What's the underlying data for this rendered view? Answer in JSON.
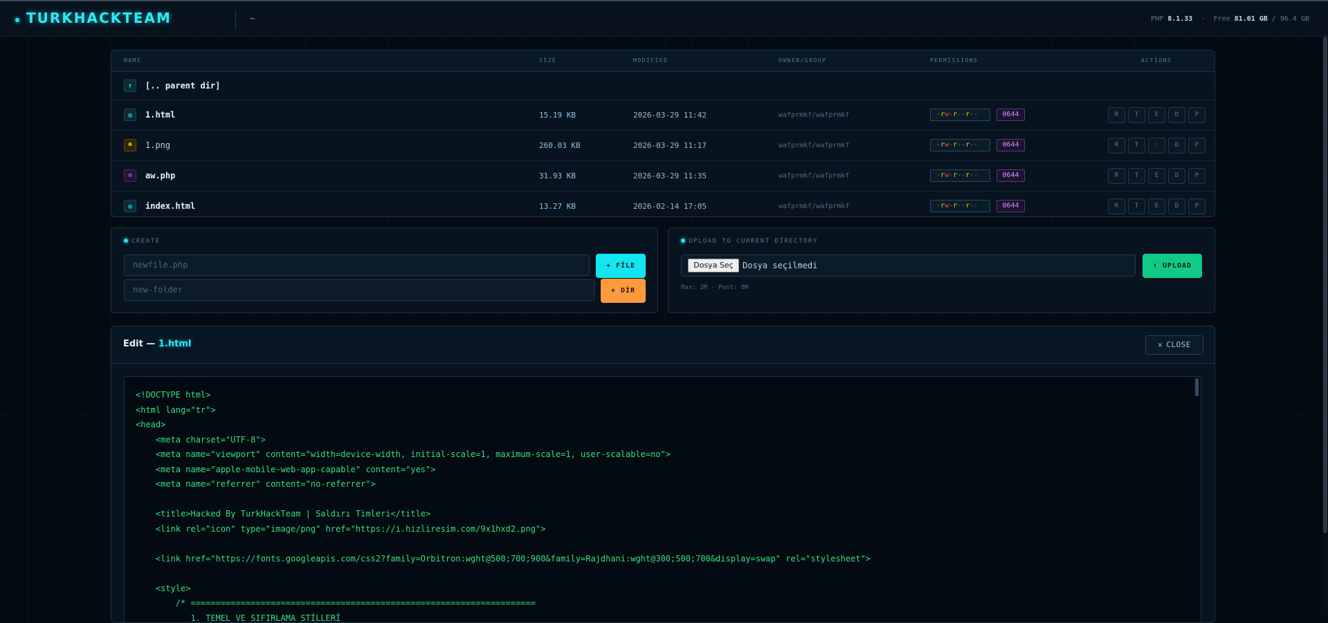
{
  "header": {
    "brand": "TURKHACKTEAM",
    "path": "~",
    "php_label": "PHP",
    "php_version": "8.1.33",
    "dot": "·",
    "free_label": "Free",
    "free_value": "81.01 GB",
    "slash": "/",
    "total_value": "96.4 GB"
  },
  "table": {
    "columns": {
      "name": "NAME",
      "size": "SİZE",
      "modified": "MODİFİED",
      "owner": "OWNER/GROUP",
      "permissions": "PERMİSSİONS",
      "actions": "ACTİONS"
    },
    "parent_label": "[.. parent dir]",
    "files": [
      {
        "name": "1.html",
        "icon": "html-file-icon",
        "glyph": "▥",
        "size": "15.19 KB",
        "modified": "2026-03-29 11:42",
        "owner": "wafprmkf/wafprmkf",
        "octal": "0644"
      },
      {
        "name": "1.png",
        "icon": "image-file-icon",
        "glyph": "☻",
        "size": "260.03 KB",
        "modified": "2026-03-29 11:17",
        "owner": "wafprmkf/wafprmkf",
        "octal": "0644"
      },
      {
        "name": "aw.php",
        "icon": "php-file-icon",
        "glyph": "⚙",
        "size": "31.93 KB",
        "modified": "2026-03-29 11:35",
        "owner": "wafprmkf/wafprmkf",
        "octal": "0644"
      },
      {
        "name": "index.html",
        "icon": "html-file-icon",
        "glyph": "▥",
        "size": "13.27 KB",
        "modified": "2026-02-14 17:05",
        "owner": "wafprmkf/wafprmkf",
        "octal": "0644"
      }
    ],
    "perm_parts": [
      "-",
      "rw",
      "-",
      "r",
      "--",
      "r",
      "--"
    ],
    "actions": [
      "R",
      "T",
      "E",
      "D",
      "P"
    ]
  },
  "create": {
    "title": "CREATE",
    "file_placeholder": "newfile.php",
    "file_button": "+ FİLE",
    "dir_placeholder": "new-folder",
    "dir_button": "+ DİR"
  },
  "upload": {
    "title": "UPLOAD TO CURRENT DİRECTORY",
    "choose_label": "Dosya Seç",
    "no_file_label": "Dosya seçilmedi",
    "button": "⬆ UPLOAD",
    "limits": "Max: 2M · Post: 8M"
  },
  "editor": {
    "title_prefix": "Edit —",
    "filename": "1.html",
    "close_label": "CLOSE",
    "lines": [
      "<!DOCTYPE html>",
      "<html lang=\"tr\">",
      "<head>",
      "    <meta charset=\"UTF-8\">",
      "    <meta name=\"viewport\" content=\"width=device-width, initial-scale=1, maximum-scale=1, user-scalable=no\">",
      "    <meta name=\"apple-mobile-web-app-capable\" content=\"yes\">",
      "    <meta name=\"referrer\" content=\"no-referrer\">",
      "",
      "    <title>Hacked By TurkHackTeam | Saldırı Timleri</title>",
      "    <link rel=\"icon\" type=\"image/png\" href=\"https://i.hizliresim.com/9x1hxd2.png\">",
      "",
      "    <link href=\"https://fonts.googleapis.com/css2?family=Orbitron:wght@500;700;900&family=Rajdhani:wght@300;500;700&display=swap\" rel=\"stylesheet\">",
      "",
      "    <style>",
      "        /* =====================================================================",
      "           1. TEMEL VE SIFIRLAMA STİLLERİ"
    ]
  }
}
